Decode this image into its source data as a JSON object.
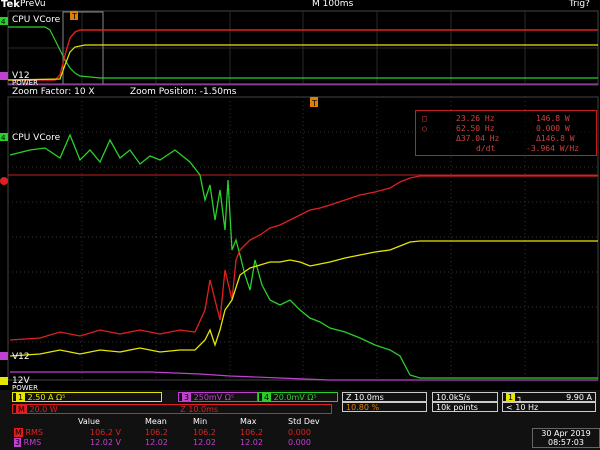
{
  "header": {
    "brand": "Tek",
    "mode": "PreVu",
    "timebase": "M 100ms",
    "trigger": "Trig?"
  },
  "zoom": {
    "factor_label": "Zoom Factor: 10 X",
    "position_label": "Zoom Position: -1.50ms"
  },
  "channels": {
    "ch4_label": "CPU VCore",
    "ch2_label": "V12",
    "power_label": "POWER",
    "ch1_label_zoom": "12V",
    "marker_a": "a"
  },
  "measurements": {
    "r1_left": "23.26 Hz",
    "r1_right": "146.8 W",
    "r2_left": "62.50 Hz",
    "r2_right": "0.000 W",
    "r3_left": "Δ37.04 Hz",
    "r3_right": "Δ146.8 W",
    "r4_left": "d/dt",
    "r4_right": "-3.964 W/Hz"
  },
  "bottom": {
    "ch1_scale": "2.50 A",
    "ch1_extra": "Ω⁵",
    "ch3_scale": "250mV",
    "ch3_extra": "Ω⁵",
    "ch4_scale": "20.0mV",
    "ch4_extra": "Ω⁵",
    "math_scale": "20.0 W",
    "math_time": "Z 10.0ms",
    "h_scale": "Z 10.0ms",
    "h_pos": "10.80 %",
    "sample_rate": "10.0kS/s",
    "points": "10k points",
    "trig_ch": "1",
    "trig_level": "9.90 A",
    "trig_freq": "< 10 Hz",
    "table_headers": [
      "Value",
      "Mean",
      "Min",
      "Max",
      "Std Dev"
    ],
    "rows": [
      {
        "label": "RMS",
        "values": [
          "106.2 V",
          "106.2",
          "106.2",
          "106.2",
          "0.000"
        ]
      },
      {
        "label": "RMS",
        "values": [
          "12.02 V",
          "12.02",
          "12.02",
          "12.02",
          "0.000"
        ]
      }
    ],
    "date": "30 Apr 2019",
    "time": "08:57:03"
  },
  "colors": {
    "yellow": "#e6e600",
    "green": "#2ad02a",
    "red": "#e02020",
    "magenta": "#c040d0"
  }
}
